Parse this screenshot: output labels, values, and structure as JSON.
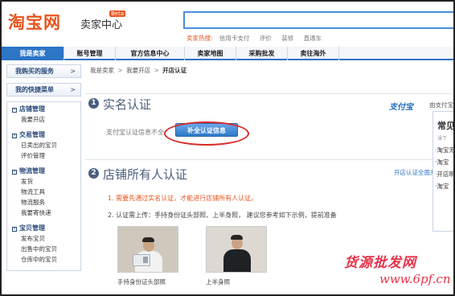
{
  "header": {
    "logo": "淘宝网",
    "subtitle": "卖家中心",
    "beta": "Beta",
    "hot_label": "卖家热搜:",
    "hot_words": [
      "信用卡支付",
      "评价",
      "装修",
      "直通车"
    ]
  },
  "nav": {
    "items": [
      "我是卖家",
      "账号管理",
      "官方信息中心",
      "卖家地图",
      "采购批发",
      "卖往海外"
    ],
    "active_index": 0
  },
  "sidebar": {
    "boxes": [
      "我购买的服务",
      "我的快捷菜单"
    ],
    "arrow": ">",
    "groups": [
      {
        "title": "店铺管理",
        "links": [
          "我要开店"
        ]
      },
      {
        "title": "交易管理",
        "links": [
          "已卖出的宝贝",
          "评价管理"
        ]
      },
      {
        "title": "物流管理",
        "links": [
          "发货",
          "物流工具",
          "物流服务",
          "我要寄快递"
        ]
      },
      {
        "title": "宝贝管理",
        "links": [
          "发布宝贝",
          "出售中的宝贝",
          "仓库中的宝贝"
        ]
      }
    ]
  },
  "breadcrumb": {
    "items": [
      "我是卖家",
      "我要开店",
      "开店认证"
    ],
    "sep": ">"
  },
  "section1": {
    "number": "1",
    "title": "实名认证",
    "alipay_logo": "支付宝",
    "alipay_text": "由支付宝提供",
    "status_text": "支付宝认证信息不全",
    "button": "补全认证信息"
  },
  "section2": {
    "number": "2",
    "title": "店铺所有人认证",
    "link": "开店认证全面升",
    "req1": "1. 需要先通过实名认证，才能进行店铺所有人认证。",
    "req2": "2. 认证需上传：手持身份证头部照、上半身照， 建议您参考如下示例，提前准备",
    "caption1": "手持身份证头部照",
    "caption2": "上半身照"
  },
  "right_panel": {
    "title": "常见",
    "subtitle": "米T",
    "items": [
      "淘宝无法认",
      "淘宝",
      "开店明",
      "淘宝"
    ]
  },
  "watermark": {
    "line1": "货源批发网",
    "line2": "www.6pf.cn"
  },
  "colors": {
    "brand_orange": "#e8541e",
    "nav_blue": "#2d75c5",
    "highlight_red": "#d82a2a"
  }
}
